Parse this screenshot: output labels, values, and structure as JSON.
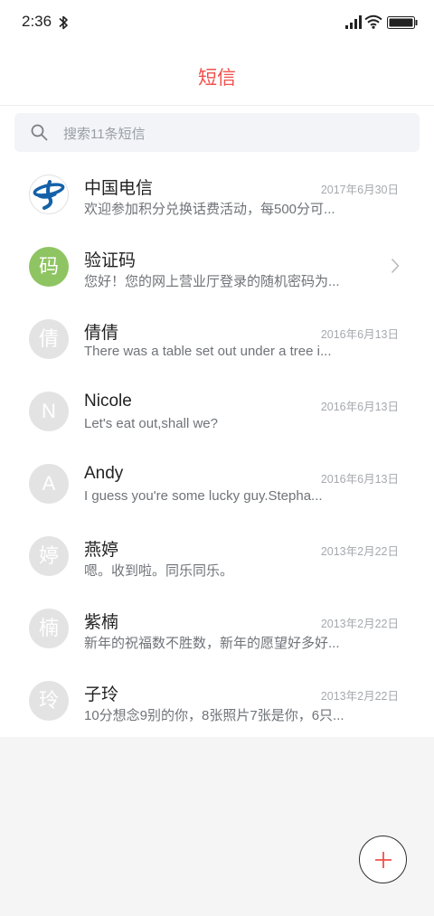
{
  "status_bar": {
    "time": "2:36",
    "icons": [
      "bluetooth-icon",
      "signal-icon",
      "wifi-icon",
      "battery-icon"
    ]
  },
  "header": {
    "title": "短信"
  },
  "search": {
    "placeholder": "搜索11条短信"
  },
  "conversations": [
    {
      "avatar": "",
      "avatar_type": "china-telecom-logo",
      "name": "中国电信",
      "preview": "欢迎参加积分兑换话费活动，每500分可...",
      "date": "2017年6月30日"
    },
    {
      "avatar": "码",
      "avatar_type": "green",
      "name": "验证码",
      "preview": "您好！您的网上营业厅登录的随机密码为...",
      "date": "",
      "has_chevron": true
    },
    {
      "avatar": "倩",
      "avatar_type": "gray",
      "name": "倩倩",
      "preview": "There was a table set out under a tree i...",
      "date": "2016年6月13日"
    },
    {
      "avatar": "N",
      "avatar_type": "gray",
      "name": "Nicole",
      "preview": "Let's eat out,shall we?",
      "date": "2016年6月13日"
    },
    {
      "avatar": "A",
      "avatar_type": "gray",
      "name": "Andy",
      "preview": "I guess you're some lucky guy.Stepha...",
      "date": "2016年6月13日"
    },
    {
      "avatar": "婷",
      "avatar_type": "gray",
      "name": "燕婷",
      "preview": "嗯。收到啦。同乐同乐。",
      "date": "2013年2月22日"
    },
    {
      "avatar": "楠",
      "avatar_type": "gray",
      "name": "紫楠",
      "preview": "新年的祝福数不胜数，新年的愿望好多好...",
      "date": "2013年2月22日"
    },
    {
      "avatar": "玲",
      "avatar_type": "gray",
      "name": "子玲",
      "preview": "10分想念9别的你，8张照片7张是你，6只...",
      "date": "2013年2月22日"
    }
  ],
  "fab": {
    "icon": "plus-icon"
  },
  "colors": {
    "accent": "#f0504b",
    "background": "#f4f5f4",
    "avatar_gray": "#e3e3e3",
    "avatar_green": "#8fc462",
    "telecom_blue": "#1561a8"
  }
}
